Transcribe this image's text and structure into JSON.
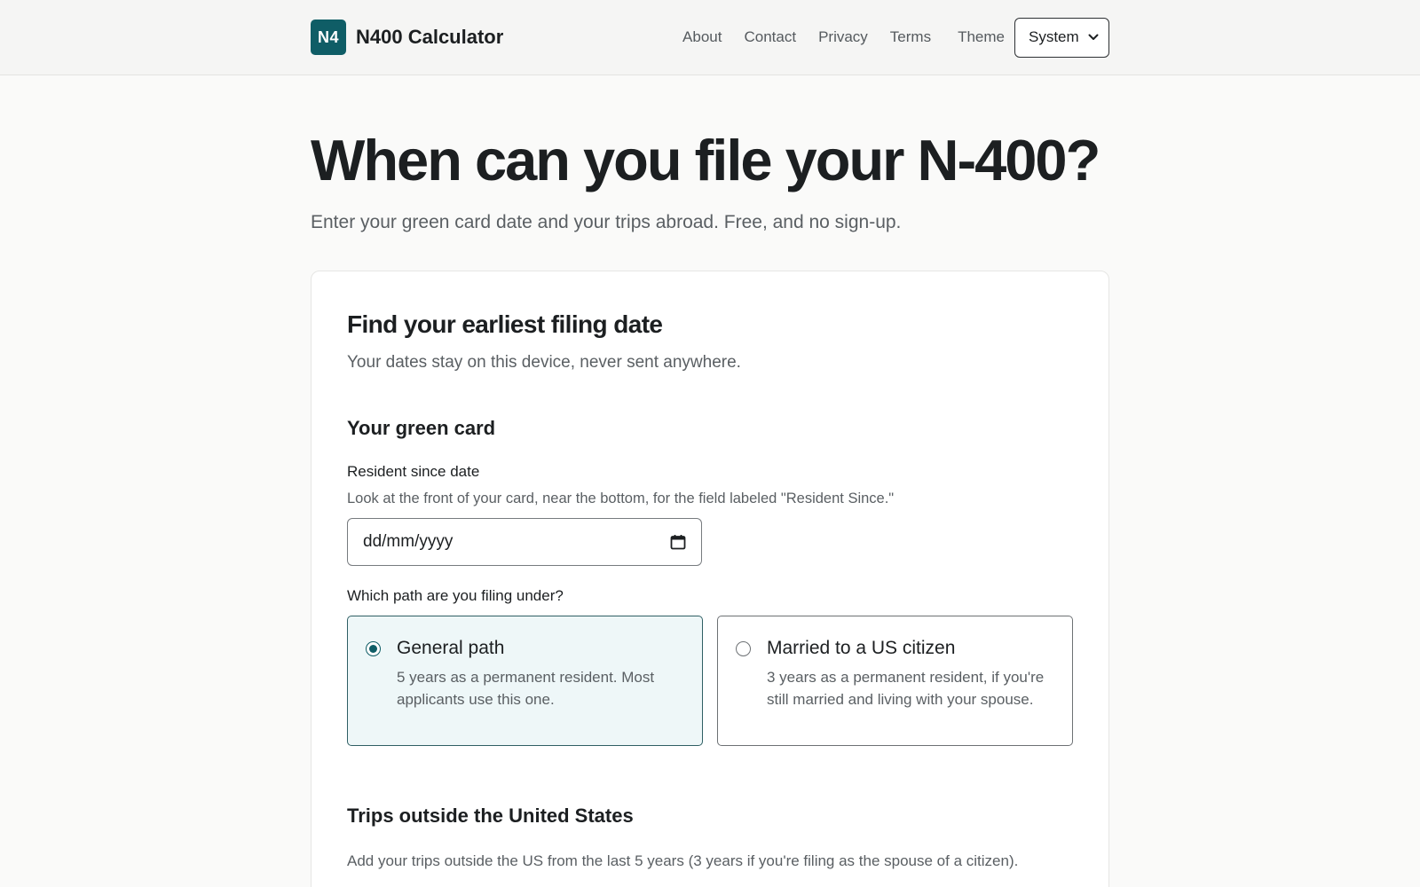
{
  "header": {
    "logo_badge": "N4",
    "logo_text": "N400 Calculator",
    "nav": {
      "about": "About",
      "contact": "Contact",
      "privacy": "Privacy",
      "terms": "Terms"
    },
    "theme_label": "Theme",
    "theme_value": "System"
  },
  "hero": {
    "title": "When can you file your N-400?",
    "subtitle": "Enter your green card date and your trips abroad. Free, and no sign-up."
  },
  "card": {
    "title": "Find your earliest filing date",
    "subtitle": "Your dates stay on this device, never sent anywhere.",
    "green_card": {
      "section_title": "Your green card",
      "field_label": "Resident since date",
      "field_help": "Look at the front of your card, near the bottom, for the field labeled \"Resident Since.\"",
      "date_placeholder": "dd/mm/yyyy"
    },
    "path": {
      "label": "Which path are you filing under?",
      "options": [
        {
          "title": "General path",
          "desc": "5 years as a permanent resident. Most applicants use this one.",
          "selected": true
        },
        {
          "title": "Married to a US citizen",
          "desc": "3 years as a permanent resident, if you're still married and living with your spouse.",
          "selected": false
        }
      ]
    },
    "trips": {
      "title": "Trips outside the United States",
      "subtitle": "Add your trips outside the US from the last 5 years (3 years if you're filing as the spouse of a citizen)."
    }
  },
  "colors": {
    "brand": "#0f5d66",
    "selected_bg": "#eef7f8",
    "page_bg": "#fafaf9"
  },
  "icons": {
    "theme_dropdown": "chevron-down-icon",
    "date_picker": "calendar-icon"
  }
}
